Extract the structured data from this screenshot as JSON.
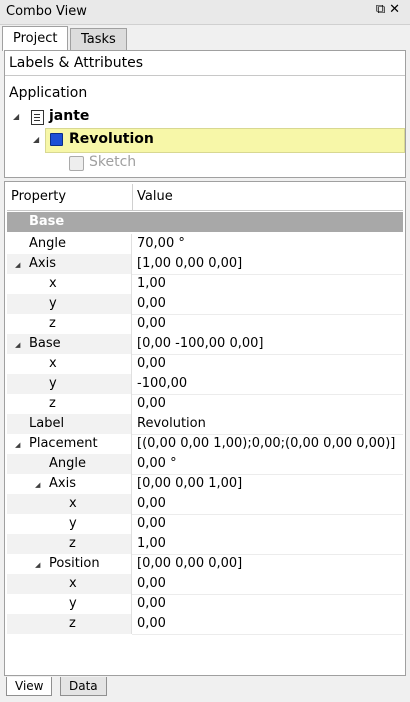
{
  "window": {
    "title": "Combo View",
    "buttons": "⧉✕"
  },
  "tabs": {
    "project": "Project",
    "tasks": "Tasks"
  },
  "tree": {
    "header": "Labels & Attributes",
    "application": "Application",
    "doc": "jante",
    "body": "Revolution",
    "sketch": "Sketch",
    "highlight_color": "#f7f7a8"
  },
  "props": {
    "col_property": "Property",
    "col_value": "Value",
    "group": "Base",
    "rows": [
      {
        "label": "Angle",
        "value": "70,00 °"
      },
      {
        "label": "Axis",
        "value": "[1,00 0,00 0,00]"
      },
      {
        "label": "x",
        "value": "1,00"
      },
      {
        "label": "y",
        "value": "0,00"
      },
      {
        "label": "z",
        "value": "0,00"
      },
      {
        "label": "Base",
        "value": "[0,00 -100,00 0,00]"
      },
      {
        "label": "x",
        "value": "0,00"
      },
      {
        "label": "y",
        "value": "-100,00"
      },
      {
        "label": "z",
        "value": "0,00"
      },
      {
        "label": "Label",
        "value": "Revolution"
      },
      {
        "label": "Placement",
        "value": "[(0,00 0,00 1,00);0,00;(0,00 0,00 0,00)]"
      },
      {
        "label": "Angle",
        "value": "0,00 °"
      },
      {
        "label": "Axis",
        "value": "[0,00 0,00 1,00]"
      },
      {
        "label": "x",
        "value": "0,00"
      },
      {
        "label": "y",
        "value": "0,00"
      },
      {
        "label": "z",
        "value": "1,00"
      },
      {
        "label": "Position",
        "value": "[0,00 0,00 0,00]"
      },
      {
        "label": "x",
        "value": "0,00"
      },
      {
        "label": "y",
        "value": "0,00"
      },
      {
        "label": "z",
        "value": "0,00"
      }
    ]
  },
  "bottom_tabs": {
    "view": "View",
    "data": "Data"
  }
}
